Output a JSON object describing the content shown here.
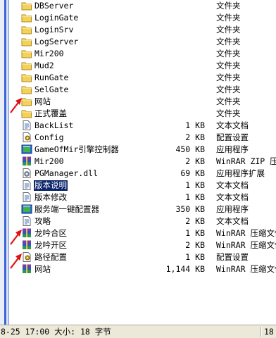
{
  "colors": {
    "selection": "#0a246a",
    "arrow": "#e01010",
    "folder": "#f3d25c"
  },
  "files": [
    {
      "name": "DBServer",
      "size": "",
      "type": "文件夹",
      "icon": "folder-icon",
      "selected": false
    },
    {
      "name": "LoginGate",
      "size": "",
      "type": "文件夹",
      "icon": "folder-icon",
      "selected": false
    },
    {
      "name": "LoginSrv",
      "size": "",
      "type": "文件夹",
      "icon": "folder-icon",
      "selected": false
    },
    {
      "name": "LogServer",
      "size": "",
      "type": "文件夹",
      "icon": "folder-icon",
      "selected": false
    },
    {
      "name": "Mir200",
      "size": "",
      "type": "文件夹",
      "icon": "folder-icon",
      "selected": false
    },
    {
      "name": "Mud2",
      "size": "",
      "type": "文件夹",
      "icon": "folder-icon",
      "selected": false
    },
    {
      "name": "RunGate",
      "size": "",
      "type": "文件夹",
      "icon": "folder-icon",
      "selected": false
    },
    {
      "name": "SelGate",
      "size": "",
      "type": "文件夹",
      "icon": "folder-icon",
      "selected": false
    },
    {
      "name": "网站",
      "size": "",
      "type": "文件夹",
      "icon": "folder-icon",
      "selected": false
    },
    {
      "name": "正式覆盖",
      "size": "",
      "type": "文件夹",
      "icon": "folder-icon",
      "selected": false
    },
    {
      "name": "BackList",
      "size": "1 KB",
      "type": "文本文档",
      "icon": "text-document-icon",
      "selected": false
    },
    {
      "name": "Config",
      "size": "2 KB",
      "type": "配置设置",
      "icon": "config-settings-icon",
      "selected": false
    },
    {
      "name": "GameOfMir引擎控制器",
      "size": "450 KB",
      "type": "应用程序",
      "icon": "application-icon",
      "selected": false
    },
    {
      "name": "Mir200",
      "size": "2 KB",
      "type": "WinRAR ZIP 压缩",
      "icon": "winrar-archive-icon",
      "selected": false
    },
    {
      "name": "PGManager.dll",
      "size": "69 KB",
      "type": "应用程序扩展",
      "icon": "dll-extension-icon",
      "selected": false
    },
    {
      "name": "版本说明",
      "size": "1 KB",
      "type": "文本文档",
      "icon": "text-document-icon",
      "selected": true
    },
    {
      "name": "版本修改",
      "size": "1 KB",
      "type": "文本文档",
      "icon": "text-document-icon",
      "selected": false
    },
    {
      "name": "服务端一键配置器",
      "size": "350 KB",
      "type": "应用程序",
      "icon": "application-icon",
      "selected": false
    },
    {
      "name": "攻略",
      "size": "2 KB",
      "type": "文本文档",
      "icon": "text-document-icon",
      "selected": false
    },
    {
      "name": "龙吟合区",
      "size": "1 KB",
      "type": "WinRAR 压缩文件",
      "icon": "winrar-archive-icon",
      "selected": false
    },
    {
      "name": "龙吟开区",
      "size": "2 KB",
      "type": "WinRAR 压缩文件",
      "icon": "winrar-archive-icon",
      "selected": false
    },
    {
      "name": "路径配置",
      "size": "1 KB",
      "type": "配置设置",
      "icon": "config-settings-icon",
      "selected": false
    },
    {
      "name": "网站",
      "size": "1,144 KB",
      "type": "WinRAR 压缩文件",
      "icon": "winrar-archive-icon",
      "selected": false
    }
  ],
  "statusbar": {
    "info": "8-25 17:00 大小: 18 字节",
    "right": "18"
  },
  "annotations": [
    {
      "name": "red-arrow-annotation",
      "target": "网站"
    },
    {
      "name": "red-arrow-annotation",
      "target": "龙吟合区"
    },
    {
      "name": "red-arrow-annotation",
      "target": "路径配置"
    }
  ]
}
